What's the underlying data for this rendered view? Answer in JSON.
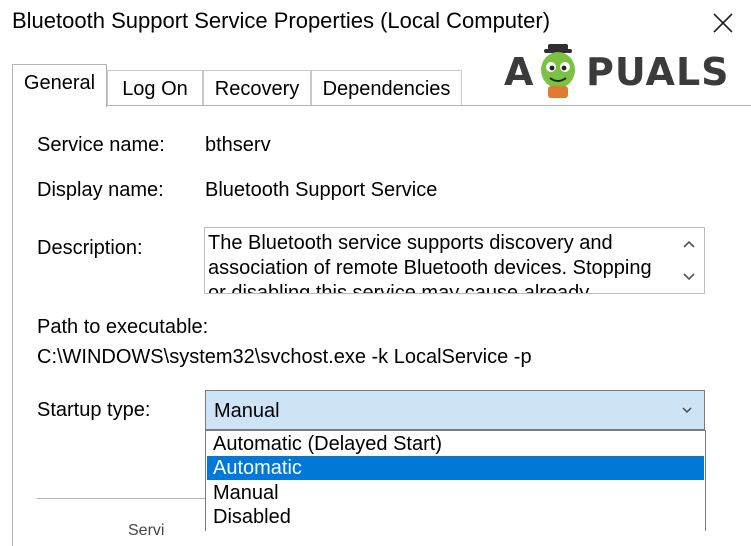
{
  "window": {
    "title": "Bluetooth Support Service Properties (Local Computer)",
    "close_icon": "close-x-icon"
  },
  "watermark": {
    "text_left": "A",
    "text_right": "PUALS",
    "mascot_icon": "appuals-mascot-icon"
  },
  "tabs": [
    {
      "label": "General",
      "active": true
    },
    {
      "label": "Log On",
      "active": false
    },
    {
      "label": "Recovery",
      "active": false
    },
    {
      "label": "Dependencies",
      "active": false
    }
  ],
  "general": {
    "service_name_label": "Service name:",
    "service_name_value": "bthserv",
    "display_name_label": "Display name:",
    "display_name_value": "Bluetooth Support Service",
    "description_label": "Description:",
    "description_lines": [
      "The Bluetooth service supports discovery and",
      "association of remote Bluetooth devices.  Stopping",
      "or disabling this service may cause already installed"
    ],
    "path_label": "Path to executable:",
    "path_value": "C:\\WINDOWS\\system32\\svchost.exe -k LocalService -p",
    "startup_type_label": "Startup type:",
    "startup_type_value": "Manual",
    "startup_options": [
      {
        "label": "Automatic (Delayed Start)",
        "highlighted": false
      },
      {
        "label": "Automatic",
        "highlighted": true
      },
      {
        "label": "Manual",
        "highlighted": false
      },
      {
        "label": "Disabled",
        "highlighted": false
      }
    ],
    "partial_text": "Servi"
  },
  "colors": {
    "highlight": "#0078d7",
    "combo_focus_bg": "#cde4f7"
  }
}
